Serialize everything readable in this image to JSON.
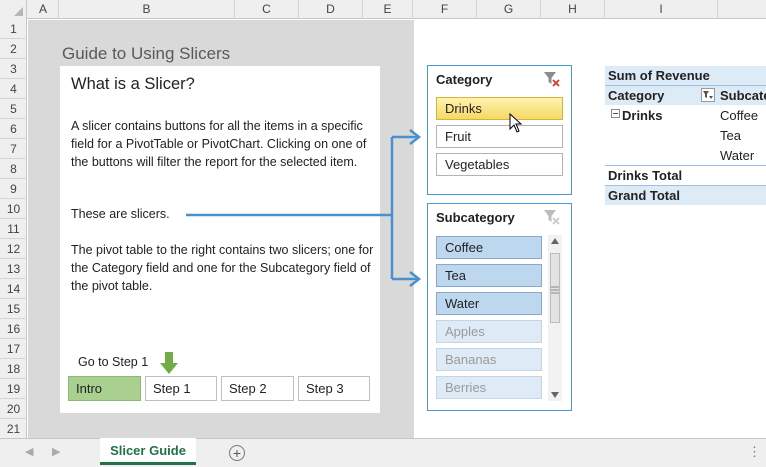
{
  "columns": [
    "A",
    "B",
    "C",
    "D",
    "E",
    "F",
    "G",
    "H",
    "I"
  ],
  "rows": [
    "1",
    "2",
    "3",
    "4",
    "5",
    "6",
    "7",
    "8",
    "9",
    "10",
    "11",
    "12",
    "13",
    "14",
    "15",
    "16",
    "17",
    "18",
    "19",
    "20",
    "21"
  ],
  "guide": {
    "title": "Guide to Using Slicers",
    "heading": "What is a Slicer?",
    "para1": "A slicer contains buttons for all the items in a specific field for a PivotTable or PivotChart. Clicking on one of the buttons will filter the report for the selected item.",
    "para2": "These are slicers.",
    "para3": "The pivot table to the right contains two slicers; one for the Category field and one for the Subcategory field of the pivot table.",
    "go_step": "Go to Step 1",
    "steps": [
      "Intro",
      "Step 1",
      "Step 2",
      "Step 3"
    ]
  },
  "slicer_category": {
    "title": "Category",
    "items": [
      "Drinks",
      "Fruit",
      "Vegetables"
    ],
    "selected": "Drinks"
  },
  "slicer_subcategory": {
    "title": "Subcategory",
    "items": [
      "Coffee",
      "Tea",
      "Water",
      "Apples",
      "Bananas",
      "Berries"
    ]
  },
  "pivot": {
    "value_header": "Sum of Revenue",
    "row_label": "Category",
    "col_label": "Subcate",
    "group": "Drinks",
    "subitems": [
      "Coffee",
      "Tea",
      "Water"
    ],
    "group_total": "Drinks Total",
    "grand_total": "Grand Total"
  },
  "sheet_tab": "Sheet tab",
  "sheet_name": "Slicer Guide",
  "add_sheet": "+",
  "colors": {
    "accent": "#217346",
    "slicer_border": "#4a9bd2",
    "step_active": "#a9d08e"
  }
}
